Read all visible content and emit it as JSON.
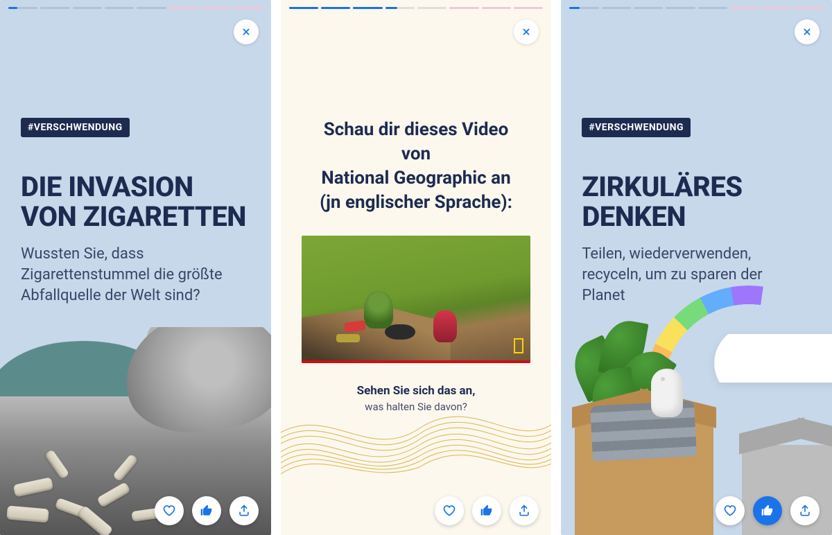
{
  "colors": {
    "brand_blue": "#1a73e8",
    "navy": "#1d2b50",
    "card_blue": "#c7d8ea",
    "card_cream": "#fcf8ee"
  },
  "progress": {
    "card1": {
      "total_segments": 8,
      "done": 0,
      "partial_index": 0,
      "pink_tail": 3
    },
    "card2": {
      "total_segments": 8,
      "done": 3,
      "partial_index": 3,
      "pink_tail": 3
    },
    "card3": {
      "total_segments": 8,
      "done": 0,
      "partial_index": 0,
      "pink_tail": 3
    }
  },
  "card1": {
    "tag": "#VERSCHWENDUNG",
    "title": "DIE INVASION VON ZIGARETTEN",
    "subtitle": "Wussten Sie, dass Zigarettenstummel die größte Abfallquelle der Welt sind?"
  },
  "card2": {
    "heading_line1": "Schau dir dieses Video von",
    "heading_line2": "National Geographic an",
    "heading_line3": "(jn englischer Sprache):",
    "cta_bold": "Sehen Sie sich das an,",
    "cta_normal": "was halten Sie davon?"
  },
  "card3": {
    "tag": "#VERSCHWENDUNG",
    "title": "ZIRKULÄRES DENKEN",
    "subtitle": "Teilen, wiederverwenden, recyceln, um zu sparen der Planet"
  },
  "actions": {
    "heart_label": "favorite",
    "like_label": "like",
    "share_label": "share"
  },
  "like_selected": {
    "card1": false,
    "card2": false,
    "card3": true
  }
}
